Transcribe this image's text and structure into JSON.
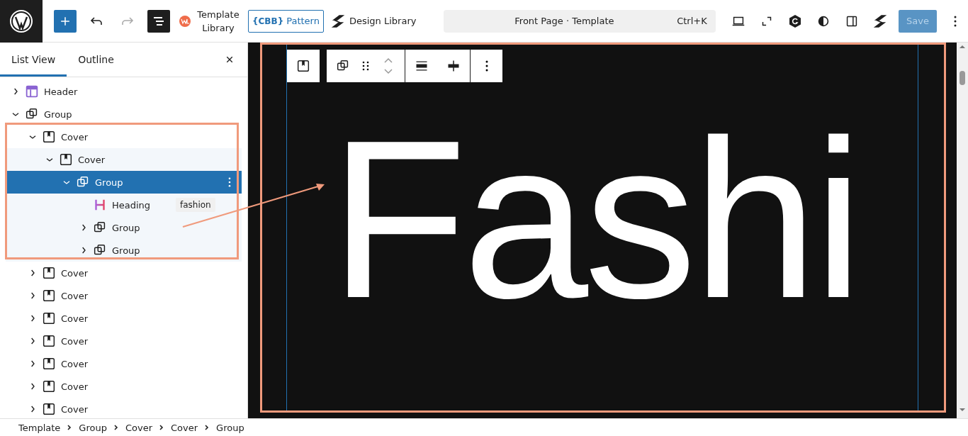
{
  "toolbar": {
    "template_library": "Template Library",
    "cbb_logo": "{CBB}",
    "pattern": "Pattern",
    "design_library": "Design Library",
    "command": "Front Page · Template",
    "shortcut": "Ctrl+K",
    "save": {
      "label": "Save",
      "disabled": true
    }
  },
  "panel": {
    "tabs": [
      {
        "label": "List View",
        "selected": true
      },
      {
        "label": "Outline",
        "selected": false
      }
    ],
    "tree": [
      {
        "kind": "header",
        "label": "Header",
        "expanded": false,
        "selected": false
      },
      {
        "kind": "group",
        "label": "Group",
        "expanded": true,
        "selected": false,
        "children": [
          {
            "kind": "cover",
            "label": "Cover",
            "expanded": true,
            "selected": false,
            "children": [
              {
                "kind": "cover",
                "label": "Cover",
                "expanded": true,
                "selected": false,
                "children": [
                  {
                    "kind": "group",
                    "label": "Group",
                    "expanded": true,
                    "selected": true,
                    "children": [
                      {
                        "kind": "heading",
                        "label": "Heading",
                        "badge": "fashion",
                        "selected": false
                      },
                      {
                        "kind": "group",
                        "label": "Group",
                        "expanded": false,
                        "selected": false
                      },
                      {
                        "kind": "group",
                        "label": "Group",
                        "expanded": false,
                        "selected": false
                      }
                    ]
                  }
                ]
              }
            ]
          },
          {
            "kind": "cover",
            "label": "Cover",
            "expanded": false,
            "selected": false
          },
          {
            "kind": "cover",
            "label": "Cover",
            "expanded": false,
            "selected": false
          },
          {
            "kind": "cover",
            "label": "Cover",
            "expanded": false,
            "selected": false
          },
          {
            "kind": "cover",
            "label": "Cover",
            "expanded": false,
            "selected": false
          },
          {
            "kind": "cover",
            "label": "Cover",
            "expanded": false,
            "selected": false
          },
          {
            "kind": "cover",
            "label": "Cover",
            "expanded": false,
            "selected": false
          },
          {
            "kind": "cover",
            "label": "Cover",
            "expanded": false,
            "selected": false
          }
        ]
      }
    ]
  },
  "canvas": {
    "heading": "Fashi"
  },
  "breadcrumbs": [
    "Template",
    "Group",
    "Cover",
    "Cover",
    "Group"
  ]
}
